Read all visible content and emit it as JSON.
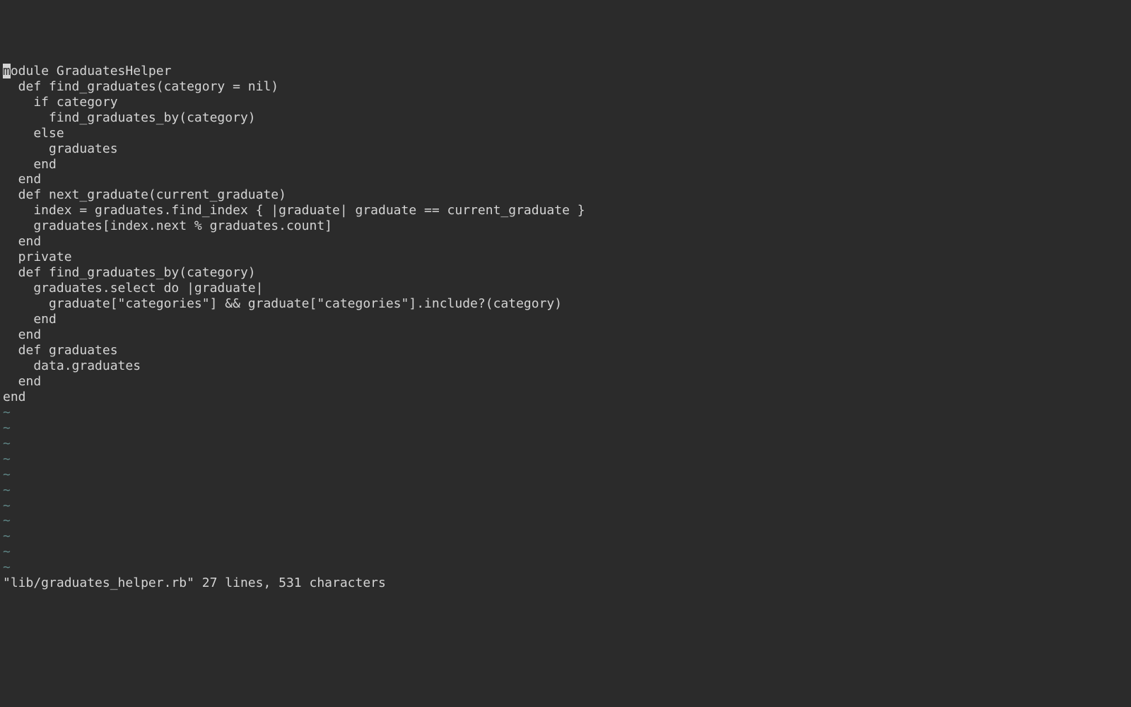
{
  "editor": {
    "cursor_char": "m",
    "lines": [
      "odule GraduatesHelper",
      "  def find_graduates(category = nil)",
      "    if category",
      "      find_graduates_by(category)",
      "    else",
      "      graduates",
      "    end",
      "  end",
      "",
      "  def next_graduate(current_graduate)",
      "    index = graduates.find_index { |graduate| graduate == current_graduate }",
      "    graduates[index.next % graduates.count]",
      "  end",
      "",
      "  private",
      "",
      "  def find_graduates_by(category)",
      "    graduates.select do |graduate|",
      "      graduate[\"categories\"] && graduate[\"categories\"].include?(category)",
      "    end",
      "  end",
      "",
      "  def graduates",
      "    data.graduates",
      "  end",
      "",
      "end"
    ],
    "tilde": "~",
    "tilde_count": 11,
    "status_line": "\"lib/graduates_helper.rb\" 27 lines, 531 characters"
  }
}
